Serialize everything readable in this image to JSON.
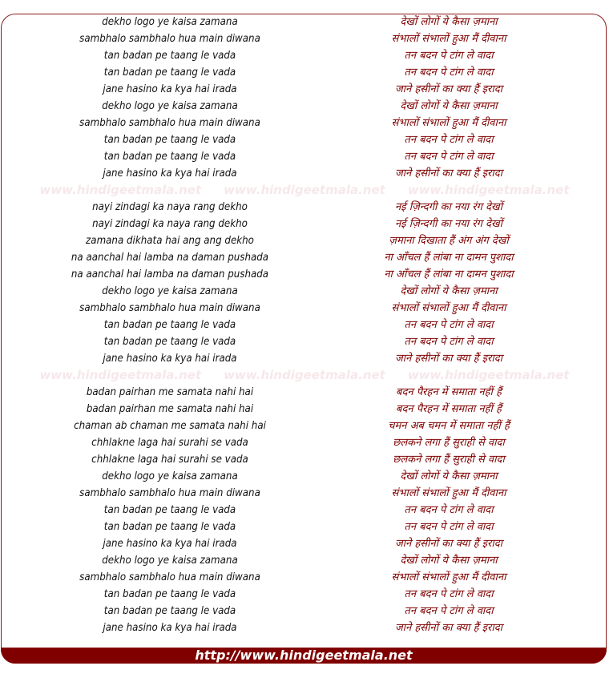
{
  "colors": {
    "border": "#8b1a1a",
    "hindi_text": "#800000",
    "footer_bg": "#800000",
    "watermark": "#f6e8ea"
  },
  "watermark": "www.hindigeetmala.net",
  "footer": {
    "url": "http://www.hindigeetmala.net"
  },
  "stanzas": [
    [
      {
        "en": "dekho logo ye kaisa zamana",
        "hi": "देखों लोगों ये कैसा ज़माना"
      },
      {
        "en": "sambhalo sambhalo hua main diwana",
        "hi": "संभालों संभालों हुआ मैं दीवाना"
      },
      {
        "en": "tan badan pe taang le vada",
        "hi": "तन बदन पे टांग ले वादा"
      },
      {
        "en": "tan badan pe taang le vada",
        "hi": "तन बदन पे टांग ले वादा"
      },
      {
        "en": "jane hasino ka kya hai irada",
        "hi": "जाने हसीनों का क्या हैं इरादा"
      },
      {
        "en": "dekho logo ye kaisa zamana",
        "hi": "देखों लोगों ये कैसा ज़माना"
      },
      {
        "en": "sambhalo sambhalo hua main diwana",
        "hi": "संभालों संभालों हुआ मैं दीवाना"
      },
      {
        "en": "tan badan pe taang le vada",
        "hi": "तन बदन पे टांग ले वादा"
      },
      {
        "en": "tan badan pe taang le vada",
        "hi": "तन बदन पे टांग ले वादा"
      },
      {
        "en": "jane hasino ka kya hai irada",
        "hi": "जाने हसीनों का क्या हैं इरादा"
      }
    ],
    [
      {
        "en": "nayi zindagi ka naya rang dekho",
        "hi": "नई ज़िन्दगी का नया रंग देखों"
      },
      {
        "en": "nayi zindagi ka naya rang dekho",
        "hi": "नई ज़िन्दगी का नया रंग देखों"
      },
      {
        "en": "zamana dikhata hai ang ang dekho",
        "hi": "ज़माना दिखाता हैं अंग अंग देखों"
      },
      {
        "en": "na aanchal hai lamba na daman pushada",
        "hi": "ना आँचल हैं लांबा ना दामन पुशादा"
      },
      {
        "en": "na aanchal hai lamba na daman pushada",
        "hi": "ना आँचल हैं लांबा ना दामन पुशादा"
      },
      {
        "en": "dekho logo ye kaisa zamana",
        "hi": "देखों लोगों ये कैसा ज़माना"
      },
      {
        "en": "sambhalo sambhalo hua main diwana",
        "hi": "संभालों संभालों हुआ मैं दीवाना"
      },
      {
        "en": "tan badan pe taang le vada",
        "hi": "तन बदन पे टांग ले वादा"
      },
      {
        "en": "tan badan pe taang le vada",
        "hi": "तन बदन पे टांग ले वादा"
      },
      {
        "en": "jane hasino ka kya hai irada",
        "hi": "जाने हसीनों का क्या हैं इरादा"
      }
    ],
    [
      {
        "en": "badan pairhan me samata nahi hai",
        "hi": "बदन पैरहन में समाता नहीं हैं"
      },
      {
        "en": "badan pairhan me samata nahi hai",
        "hi": "बदन पैरहन में समाता नहीं हैं"
      },
      {
        "en": "chaman ab chaman me samata nahi hai",
        "hi": "चमन अब चमन में समाता नहीं हैं"
      },
      {
        "en": "chhlakne laga hai surahi se vada",
        "hi": "छलकने लगा हैं सुराही से वादा"
      },
      {
        "en": "chhlakne laga hai surahi se vada",
        "hi": "छलकने लगा हैं सुराही से वादा"
      },
      {
        "en": "dekho logo ye kaisa zamana",
        "hi": "देखों लोगों ये कैसा ज़माना"
      },
      {
        "en": "sambhalo sambhalo hua main diwana",
        "hi": "संभालों संभालों हुआ मैं दीवाना"
      },
      {
        "en": "tan badan pe taang le vada",
        "hi": "तन बदन पे टांग ले वादा"
      },
      {
        "en": "tan badan pe taang le vada",
        "hi": "तन बदन पे टांग ले वादा"
      },
      {
        "en": "jane hasino ka kya hai irada",
        "hi": "जाने हसीनों का क्या हैं इरादा"
      },
      {
        "en": "dekho logo ye kaisa zamana",
        "hi": "देखों लोगों ये कैसा ज़माना"
      },
      {
        "en": "sambhalo sambhalo hua main diwana",
        "hi": "संभालों संभालों हुआ मैं दीवाना"
      },
      {
        "en": "tan badan pe taang le vada",
        "hi": "तन बदन पे टांग ले वादा"
      },
      {
        "en": "tan badan pe taang le vada",
        "hi": "तन बदन पे टांग ले वादा"
      },
      {
        "en": "jane hasino ka kya hai irada",
        "hi": "जाने हसीनों का क्या हैं इरादा"
      }
    ]
  ]
}
